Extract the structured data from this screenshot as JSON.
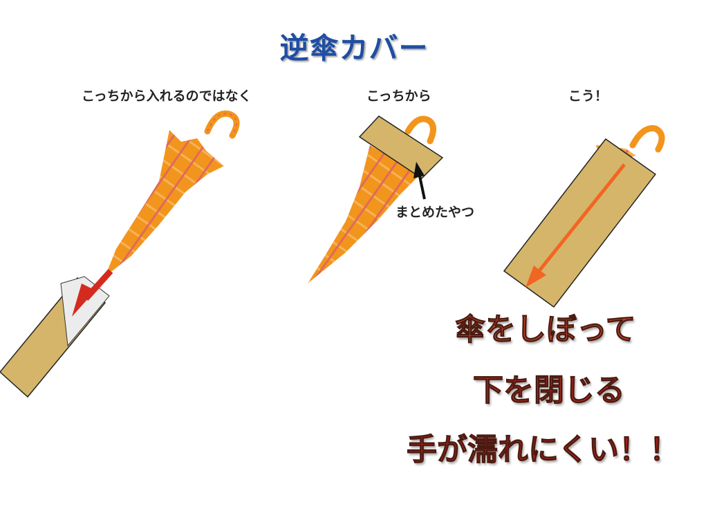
{
  "title": "逆傘カバー",
  "labels": {
    "not_this_way": "こっちから入れるのではなく",
    "this_way": "こっちから",
    "like_this": "こう！",
    "gathered_part": "まとめたやつ"
  },
  "captions": [
    "傘をしぼって",
    "下を閉じる",
    "手が濡れにくい！！"
  ],
  "colors": {
    "title": "#1f4ea3",
    "umbrella": "#f2951c",
    "cover": "#d4b56a",
    "arrow_red": "#d42b1e",
    "arrow_orange": "#f26522",
    "caption": "#b3261c"
  }
}
